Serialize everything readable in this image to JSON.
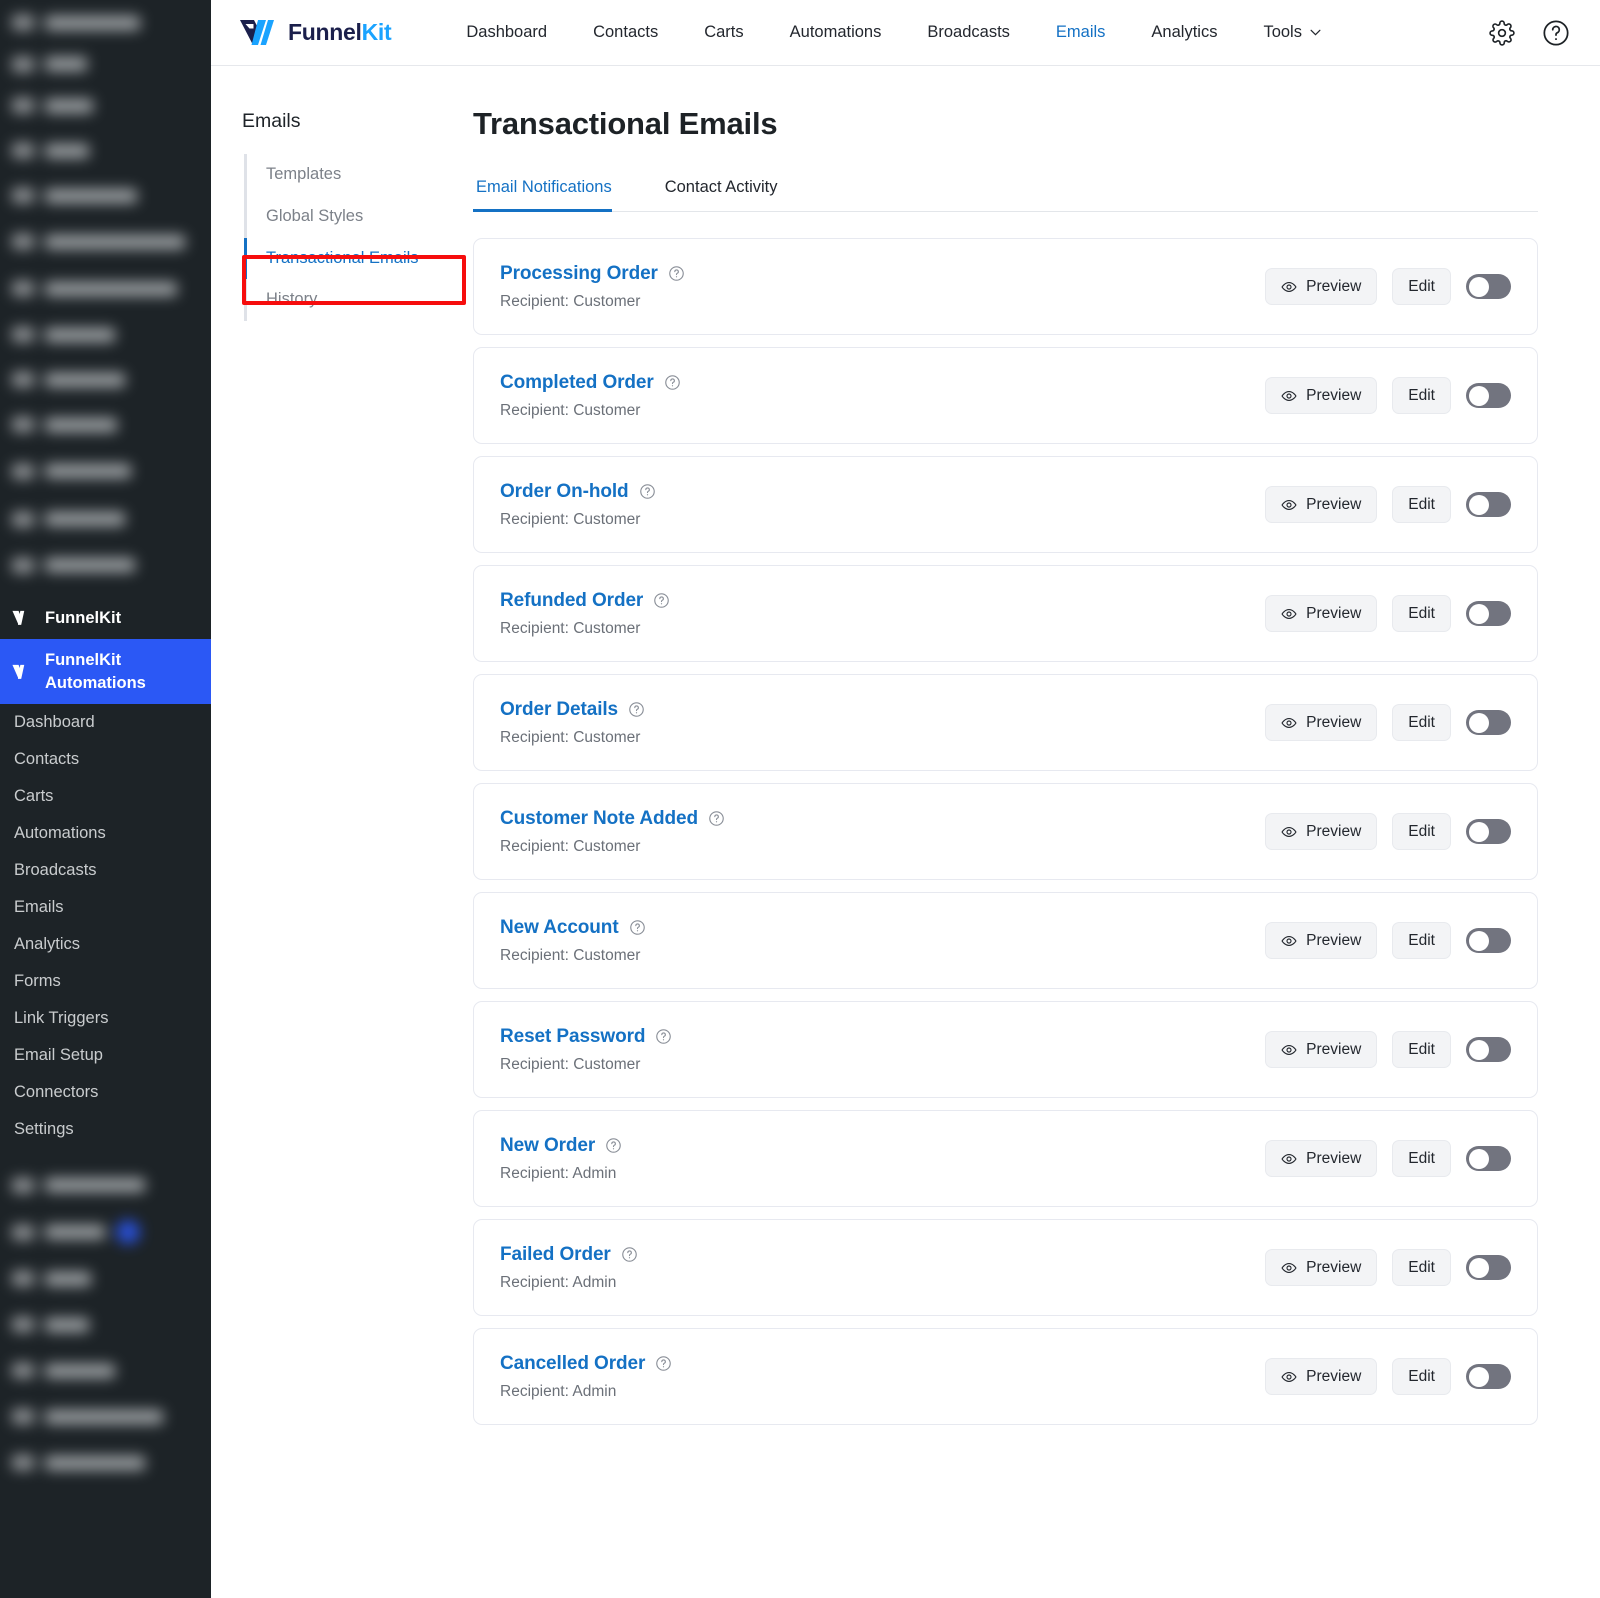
{
  "wp_sidebar": {
    "brand_label": "FunnelKit",
    "active_parent_label": "FunnelKit Automations",
    "items": [
      {
        "label": "Dashboard"
      },
      {
        "label": "Contacts"
      },
      {
        "label": "Carts"
      },
      {
        "label": "Automations"
      },
      {
        "label": "Broadcasts"
      },
      {
        "label": "Emails"
      },
      {
        "label": "Analytics"
      },
      {
        "label": "Forms"
      },
      {
        "label": "Link Triggers"
      },
      {
        "label": "Email Setup"
      },
      {
        "label": "Connectors"
      },
      {
        "label": "Settings"
      }
    ]
  },
  "topbar": {
    "logo_text_dark": "Funnel",
    "logo_text_blue": "Kit",
    "nav": [
      {
        "label": "Dashboard",
        "active": false
      },
      {
        "label": "Contacts",
        "active": false
      },
      {
        "label": "Carts",
        "active": false
      },
      {
        "label": "Automations",
        "active": false
      },
      {
        "label": "Broadcasts",
        "active": false
      },
      {
        "label": "Emails",
        "active": true
      },
      {
        "label": "Analytics",
        "active": false
      },
      {
        "label": "Tools",
        "active": false,
        "caret": true
      }
    ],
    "settings_icon": "gear-icon",
    "help_icon": "question-circle-icon"
  },
  "subnav": {
    "title": "Emails",
    "items": [
      {
        "label": "Templates",
        "active": false
      },
      {
        "label": "Global Styles",
        "active": false
      },
      {
        "label": "Transactional Emails",
        "active": true
      },
      {
        "label": "History",
        "active": false
      }
    ],
    "highlight_color": "#f60d0d"
  },
  "main": {
    "page_title": "Transactional Emails",
    "tabs": [
      {
        "label": "Email Notifications",
        "active": true
      },
      {
        "label": "Contact Activity",
        "active": false
      }
    ],
    "preview_label": "Preview",
    "edit_label": "Edit",
    "accent_color": "#1471c4",
    "emails": [
      {
        "title": "Processing Order",
        "recipient": "Recipient: Customer",
        "enabled": false
      },
      {
        "title": "Completed Order",
        "recipient": "Recipient: Customer",
        "enabled": false
      },
      {
        "title": "Order On-hold",
        "recipient": "Recipient: Customer",
        "enabled": false
      },
      {
        "title": "Refunded Order",
        "recipient": "Recipient: Customer",
        "enabled": false
      },
      {
        "title": "Order Details",
        "recipient": "Recipient: Customer",
        "enabled": false
      },
      {
        "title": "Customer Note Added",
        "recipient": "Recipient: Customer",
        "enabled": false
      },
      {
        "title": "New Account",
        "recipient": "Recipient: Customer",
        "enabled": false
      },
      {
        "title": "Reset Password",
        "recipient": "Recipient: Customer",
        "enabled": false
      },
      {
        "title": "New Order",
        "recipient": "Recipient: Admin",
        "enabled": false
      },
      {
        "title": "Failed Order",
        "recipient": "Recipient: Admin",
        "enabled": false
      },
      {
        "title": "Cancelled Order",
        "recipient": "Recipient: Admin",
        "enabled": false
      }
    ]
  }
}
